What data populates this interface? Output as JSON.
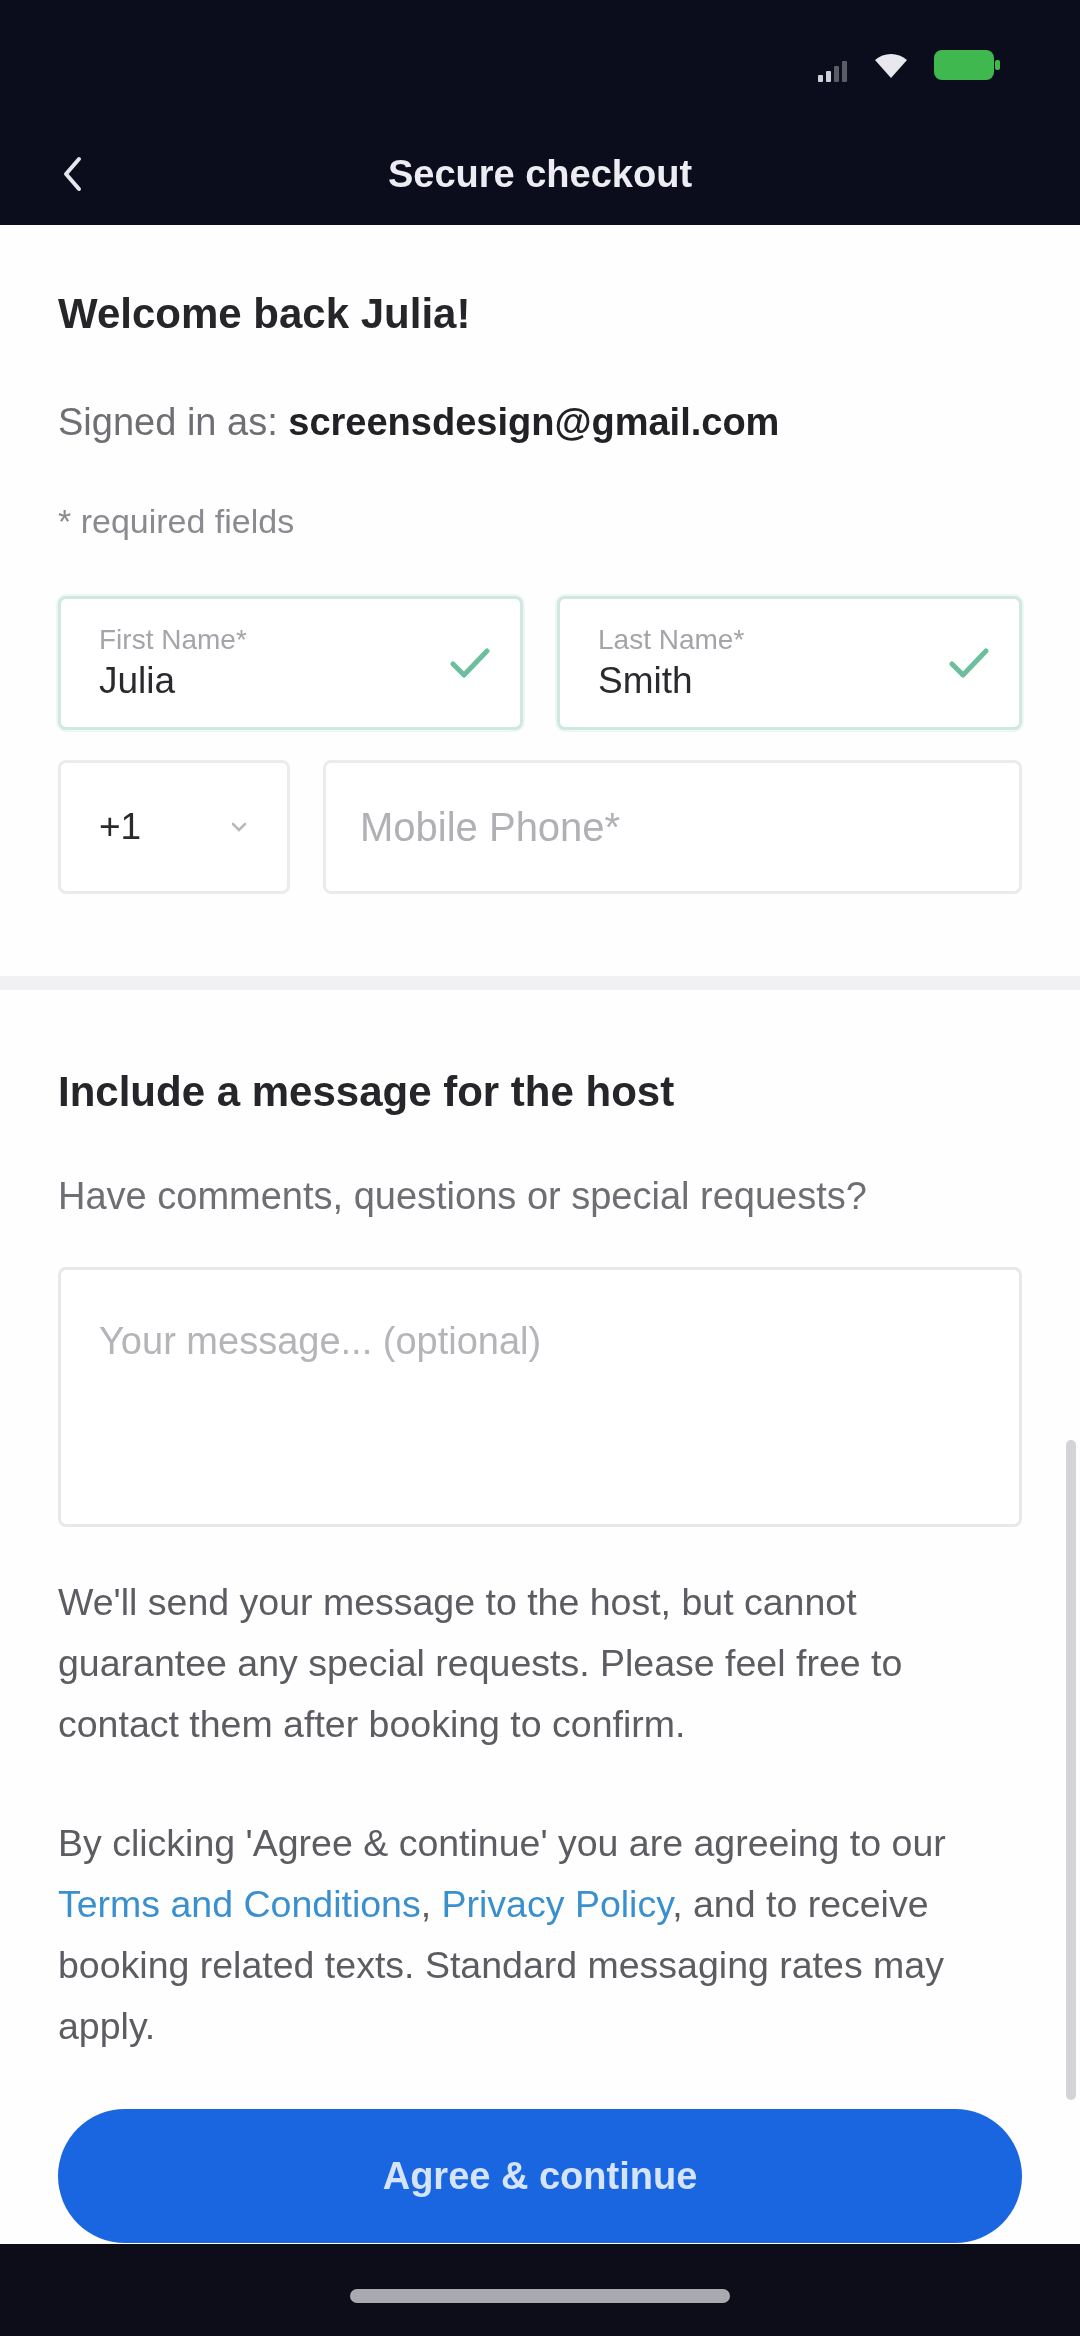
{
  "header": {
    "title": "Secure checkout"
  },
  "account": {
    "greeting": "Welcome back Julia!",
    "signed_in": "Signed in as: **screensdesign@gmail.com**",
    "required_note": "* required fields"
  },
  "name_fields": [
    {
      "label": "First Name*",
      "value": "Julia",
      "valid": true
    },
    {
      "label": "Last Name*",
      "value": "Smith",
      "valid": true
    }
  ],
  "phone": {
    "country_code": "+1",
    "placeholder": "Mobile Phone*"
  },
  "message": {
    "heading": "Include a message for the host",
    "prompt": "Have comments, questions or special requests?",
    "placeholder": "Your message... (optional)",
    "note": "We'll send your message to the host, but cannot guarantee any special requests. Please feel free to contact them after booking to confirm."
  },
  "consent": [
    {
      "kind": "text",
      "text": "By clicking 'Agree & continue' you are agreeing to our "
    },
    {
      "kind": "link",
      "text": "Terms and Conditions"
    },
    {
      "kind": "text",
      "text": ", "
    },
    {
      "kind": "link",
      "text": "Privacy Policy"
    },
    {
      "kind": "text",
      "text": ", and to receive booking related texts. Standard messaging rates may apply."
    }
  ],
  "button": {
    "label": "Agree & continue"
  }
}
